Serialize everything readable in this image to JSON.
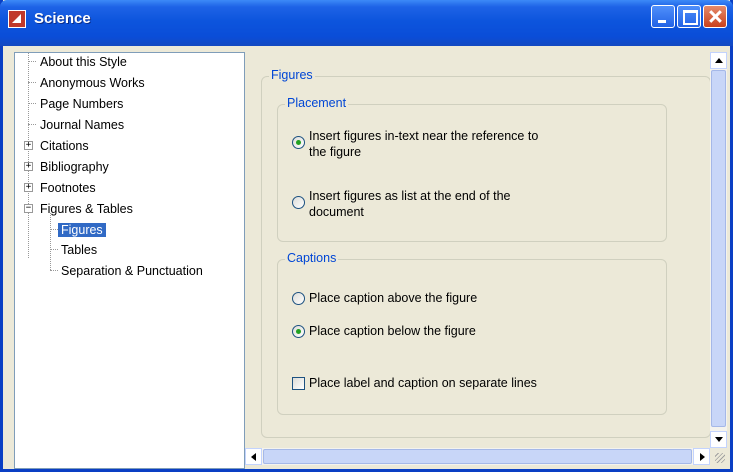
{
  "window": {
    "title": "Science"
  },
  "tree": {
    "items": [
      {
        "label": "About this Style"
      },
      {
        "label": "Anonymous Works"
      },
      {
        "label": "Page Numbers"
      },
      {
        "label": "Journal Names"
      },
      {
        "label": "Citations",
        "expander": "+"
      },
      {
        "label": "Bibliography",
        "expander": "+"
      },
      {
        "label": "Footnotes",
        "expander": "+"
      },
      {
        "label": "Figures & Tables",
        "expander": "−"
      },
      {
        "label": "Figures",
        "selected": true
      },
      {
        "label": "Tables"
      },
      {
        "label": "Separation & Punctuation"
      }
    ]
  },
  "panel": {
    "title": "Figures",
    "placement": {
      "legend": "Placement",
      "option1_line1": "Insert figures in-text near the reference to",
      "option1_line2": "the figure",
      "option2_line1": "Insert figures as list at the end of the",
      "option2_line2": "document",
      "selected": "option1"
    },
    "captions": {
      "legend": "Captions",
      "above": "Place caption above the figure",
      "below": "Place caption below the figure",
      "separate_lines": "Place label and caption on separate lines",
      "selected": "below",
      "separate_lines_checked": false
    }
  }
}
